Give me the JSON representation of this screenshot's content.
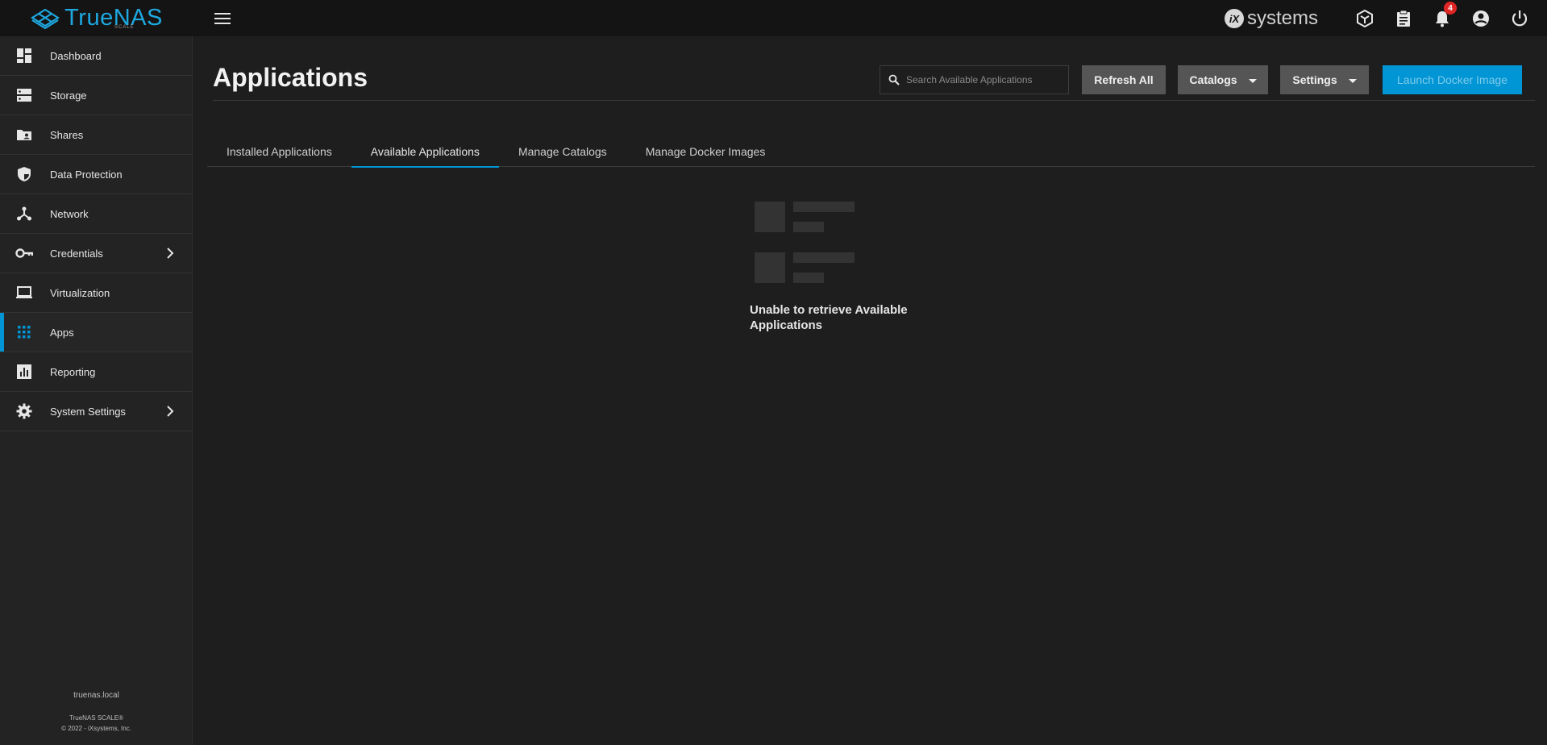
{
  "brand": {
    "name": "TrueNAS",
    "sub": "SCALE"
  },
  "topbar": {
    "vendor_mark": "iX",
    "vendor_name": "systems",
    "notification_count": "4"
  },
  "sidebar": {
    "items": [
      {
        "label": "Dashboard",
        "icon": "dashboard-icon"
      },
      {
        "label": "Storage",
        "icon": "storage-icon"
      },
      {
        "label": "Shares",
        "icon": "shares-icon"
      },
      {
        "label": "Data Protection",
        "icon": "shield-icon"
      },
      {
        "label": "Network",
        "icon": "network-icon"
      },
      {
        "label": "Credentials",
        "icon": "key-icon"
      },
      {
        "label": "Virtualization",
        "icon": "laptop-icon"
      },
      {
        "label": "Apps",
        "icon": "apps-grid-icon"
      },
      {
        "label": "Reporting",
        "icon": "chart-icon"
      },
      {
        "label": "System Settings",
        "icon": "gear-icon"
      }
    ],
    "footer": {
      "hostname": "truenas.local",
      "product": "TrueNAS SCALE®",
      "copyright": "© 2022 - iXsystems, Inc."
    }
  },
  "main": {
    "title": "Applications",
    "search_placeholder": "Search Available Applications",
    "buttons": {
      "refresh": "Refresh All",
      "catalogs": "Catalogs",
      "settings": "Settings",
      "launch": "Launch Docker Image"
    },
    "tabs": [
      {
        "label": "Installed Applications"
      },
      {
        "label": "Available Applications"
      },
      {
        "label": "Manage Catalogs"
      },
      {
        "label": "Manage Docker Images"
      }
    ],
    "empty_message": "Unable to retrieve Available Applications"
  },
  "colors": {
    "accent": "#0095d5",
    "brand": "#1ea8e0",
    "badge": "#e02525"
  }
}
